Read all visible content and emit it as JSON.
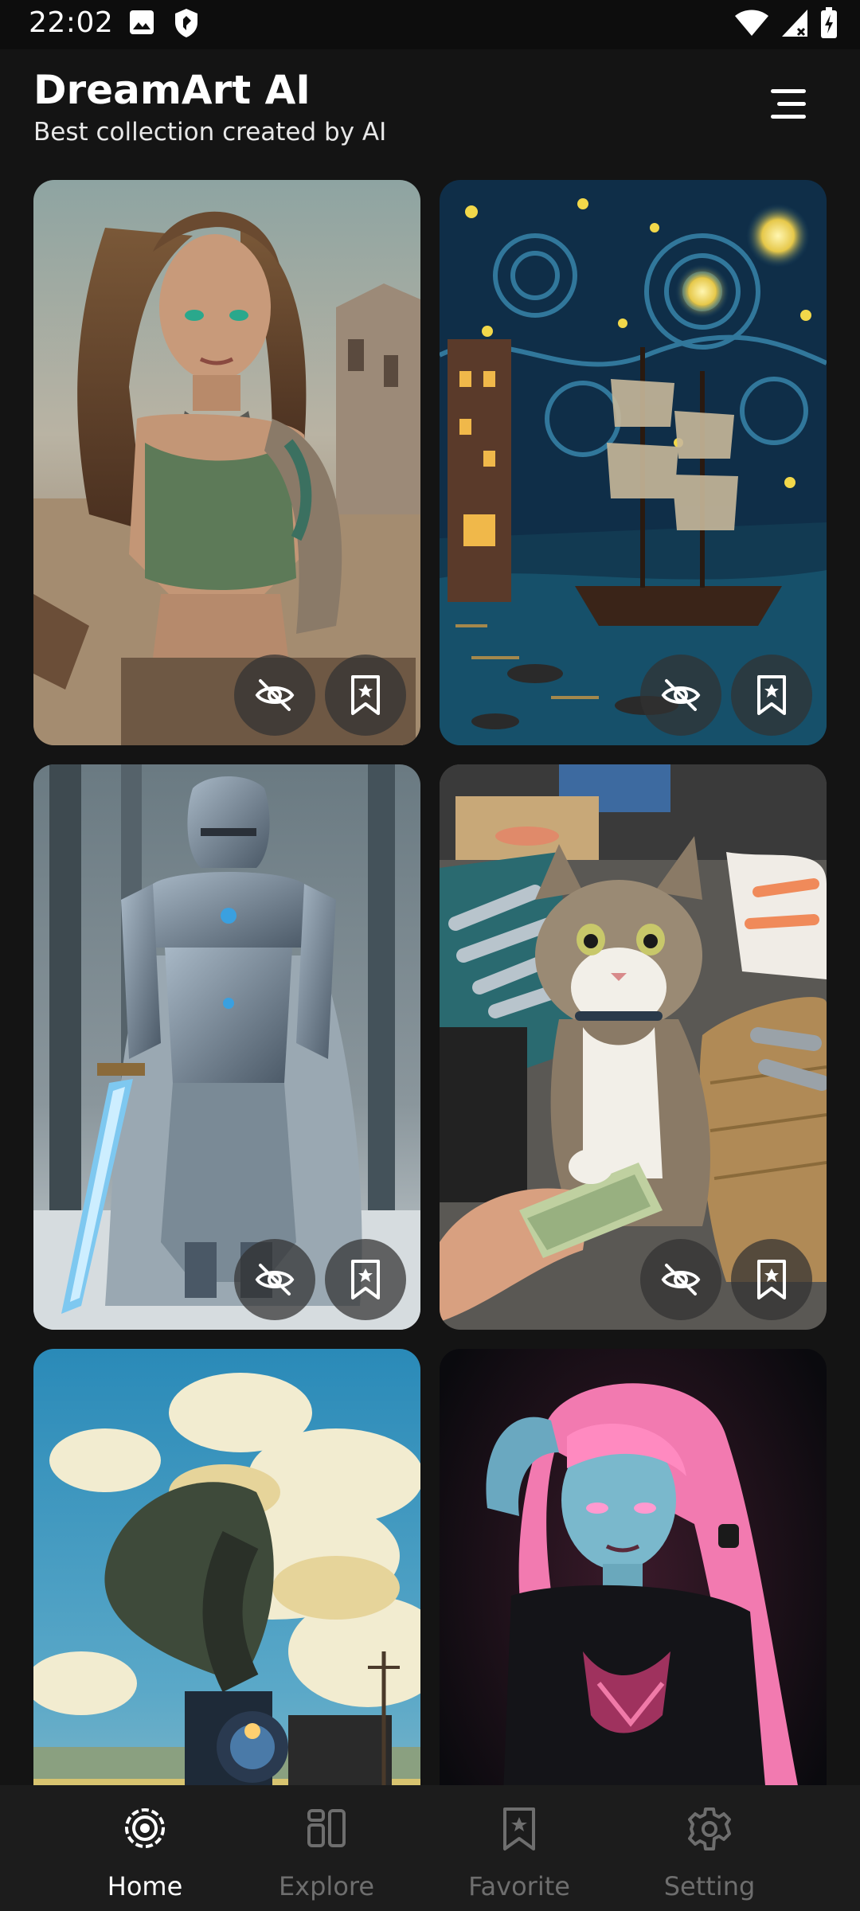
{
  "status_bar": {
    "time": "22:02",
    "icons": [
      "image-icon",
      "shield-icon",
      "wifi-icon",
      "signal-icon",
      "battery-icon"
    ]
  },
  "header": {
    "title": "DreamArt AI",
    "subtitle": "Best collection created by AI",
    "menu_icon": "menu-icon"
  },
  "gallery": {
    "cards": [
      {
        "subject": "desert-warrior-woman",
        "actions": [
          "hide-icon",
          "bookmark-icon"
        ]
      },
      {
        "subject": "starry-night-ship",
        "actions": [
          "hide-icon",
          "bookmark-icon"
        ]
      },
      {
        "subject": "armored-knight-snow",
        "actions": [
          "hide-icon",
          "bookmark-icon"
        ]
      },
      {
        "subject": "cat-fish-market",
        "actions": [
          "hide-icon",
          "bookmark-icon"
        ]
      },
      {
        "subject": "steam-train-clouds",
        "actions": []
      },
      {
        "subject": "neon-pink-hair-girl",
        "actions": []
      }
    ]
  },
  "bottom_nav": {
    "items": [
      {
        "label": "Home",
        "icon": "home-icon",
        "active": true
      },
      {
        "label": "Explore",
        "icon": "explore-icon",
        "active": false
      },
      {
        "label": "Favorite",
        "icon": "favorite-icon",
        "active": false
      },
      {
        "label": "Setting",
        "icon": "setting-icon",
        "active": false
      }
    ]
  },
  "colors": {
    "background": "#141414",
    "nav_background": "#1c1c1c",
    "active": "#ffffff",
    "inactive": "#6e6e6e"
  }
}
